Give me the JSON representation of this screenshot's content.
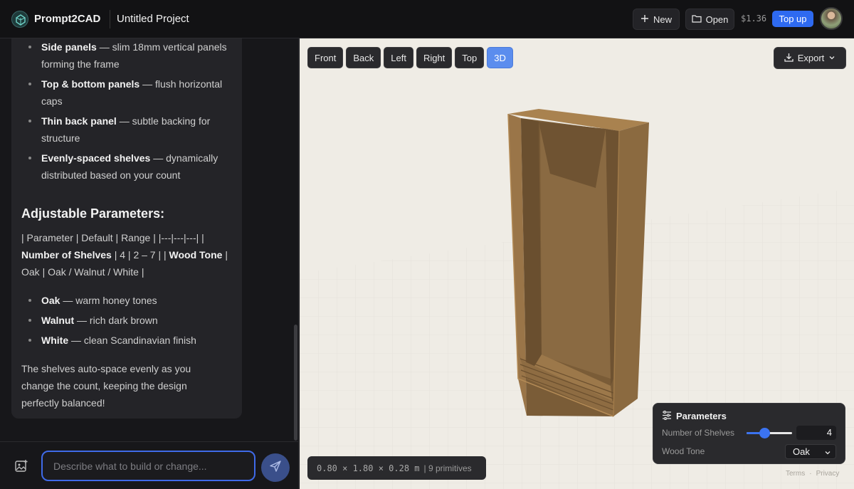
{
  "app": {
    "name": "Prompt2CAD",
    "project": "Untitled Project"
  },
  "topbar": {
    "new_label": "New",
    "open_label": "Open",
    "balance": "$1.36",
    "topup_label": "Top up"
  },
  "chat": {
    "parts": [
      {
        "term": "Side panels",
        "desc": "— slim 18mm vertical panels forming the frame"
      },
      {
        "term": "Top & bottom panels",
        "desc": "— flush horizontal caps"
      },
      {
        "term": "Thin back panel",
        "desc": "— subtle backing for structure"
      },
      {
        "term": "Evenly-spaced shelves",
        "desc": "— dynamically distributed based on your count"
      }
    ],
    "params_heading": "Adjustable Parameters:",
    "table_line1": "| Parameter | Default | Range | |---|---|---| |",
    "table_term1": "Number of Shelves",
    "table_line2": "| 4 | 2 – 7 | |",
    "table_term2": "Wood Tone",
    "table_line3": "| Oak | Oak / Walnut / White |",
    "tones": [
      {
        "term": "Oak",
        "desc": "— warm honey tones"
      },
      {
        "term": "Walnut",
        "desc": "— rich dark brown"
      },
      {
        "term": "White",
        "desc": "— clean Scandinavian finish"
      }
    ],
    "closing": "The shelves auto-space evenly as you change the count, keeping the design perfectly balanced!",
    "input_placeholder": "Describe what to build or change..."
  },
  "viewport": {
    "views": [
      "Front",
      "Back",
      "Left",
      "Right",
      "Top",
      "3D"
    ],
    "active_view": "3D",
    "export_label": "Export",
    "dimensions": "0.80 × 1.80 × 0.28 m",
    "primitives": "| 9 primitives"
  },
  "parameters": {
    "title": "Parameters",
    "shelves_label": "Number of Shelves",
    "shelves_value": "4",
    "shelves_min": 2,
    "shelves_max": 7,
    "wood_label": "Wood Tone",
    "wood_value": "Oak"
  },
  "footer": {
    "terms": "Terms",
    "privacy": "Privacy",
    "sep": "·"
  },
  "colors": {
    "accent": "#2e6af0",
    "active_view": "#5b8dee",
    "wood": "#8a6a43"
  }
}
